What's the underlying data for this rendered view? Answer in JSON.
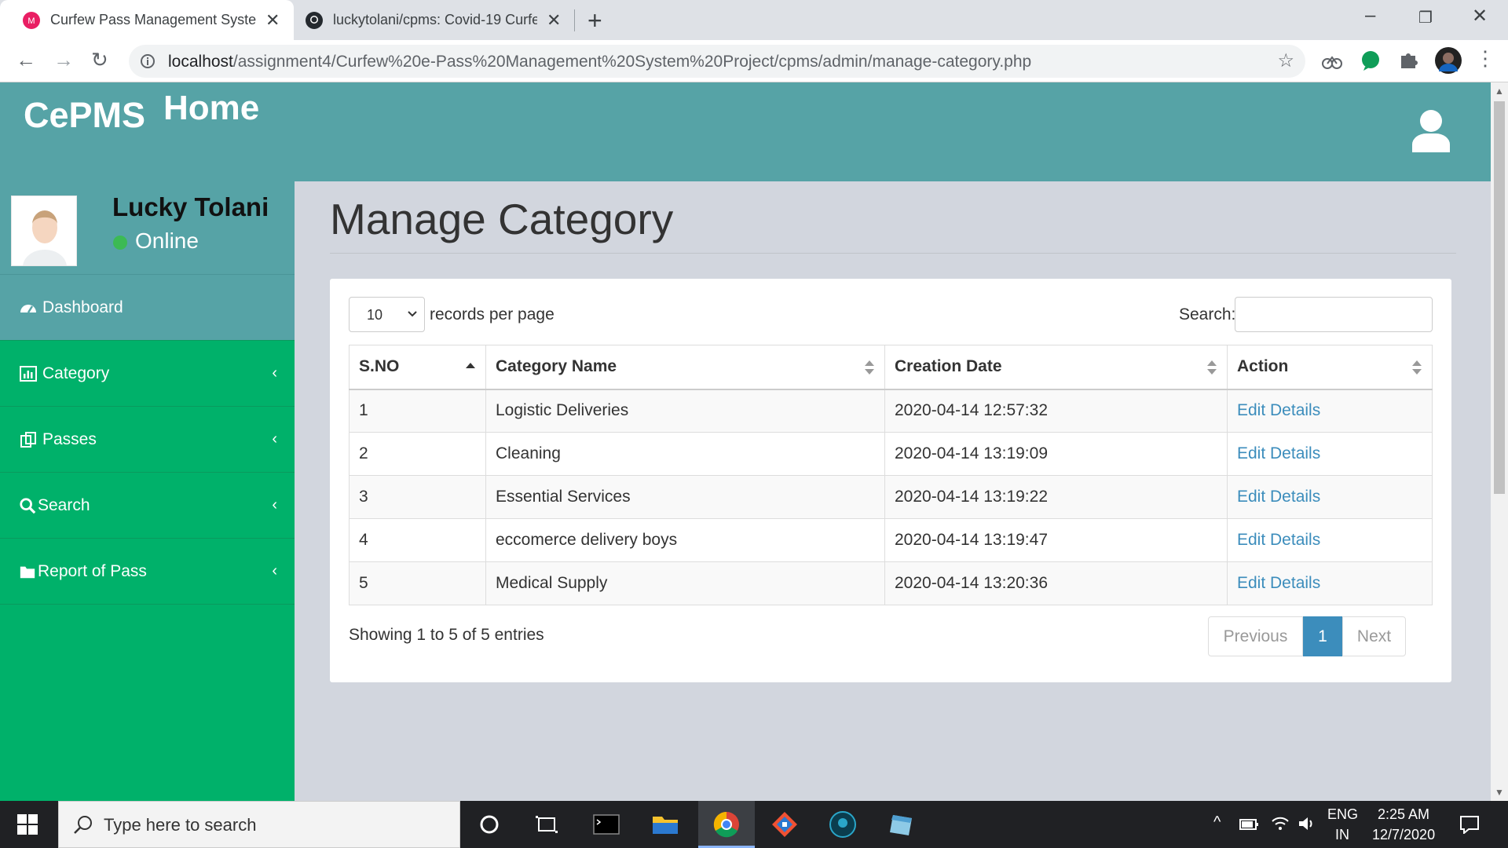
{
  "browser": {
    "tabs": [
      {
        "title": "Curfew Pass Management System",
        "active": true
      },
      {
        "title": "luckytolani/cpms: Covid-19 Curfew",
        "active": false
      }
    ],
    "url_host": "localhost",
    "url_path": "/assignment4/Curfew%20e-Pass%20Management%20System%20Project/cpms/admin/manage-category.php"
  },
  "header": {
    "logo": "CePMS",
    "home_link": "Home"
  },
  "sidebar": {
    "user_name": "Lucky Tolani",
    "status": "Online",
    "items": [
      {
        "label": "Dashboard",
        "icon": "dashboard-icon"
      },
      {
        "label": "Category",
        "icon": "bar-chart-icon"
      },
      {
        "label": "Passes",
        "icon": "copy-icon"
      },
      {
        "label": "Search",
        "icon": "search-icon"
      },
      {
        "label": "Report of Pass",
        "icon": "folder-icon"
      }
    ]
  },
  "main": {
    "title": "Manage Category",
    "length_value": "10",
    "length_label": "records per page",
    "search_label": "Search:",
    "columns": [
      "S.NO",
      "Category Name",
      "Creation Date",
      "Action"
    ],
    "rows": [
      [
        "1",
        "Logistic Deliveries",
        "2020-04-14 12:57:32",
        "Edit Details"
      ],
      [
        "2",
        "Cleaning",
        "2020-04-14 13:19:09",
        "Edit Details"
      ],
      [
        "3",
        "Essential Services",
        "2020-04-14 13:19:22",
        "Edit Details"
      ],
      [
        "4",
        "eccomerce delivery boys",
        "2020-04-14 13:19:47",
        "Edit Details"
      ],
      [
        "5",
        "Medical Supply",
        "2020-04-14 13:20:36",
        "Edit Details"
      ]
    ],
    "info": "Showing 1 to 5 of 5 entries",
    "pager": {
      "previous": "Previous",
      "current": "1",
      "next": "Next"
    }
  },
  "taskbar": {
    "search_placeholder": "Type here to search",
    "lang_top": "ENG",
    "lang_bottom": "IN",
    "time": "2:25 AM",
    "date": "12/7/2020"
  },
  "colors": {
    "header": "#56a3a6",
    "sidebar": "#00b16a",
    "link": "#3c8dbc"
  }
}
